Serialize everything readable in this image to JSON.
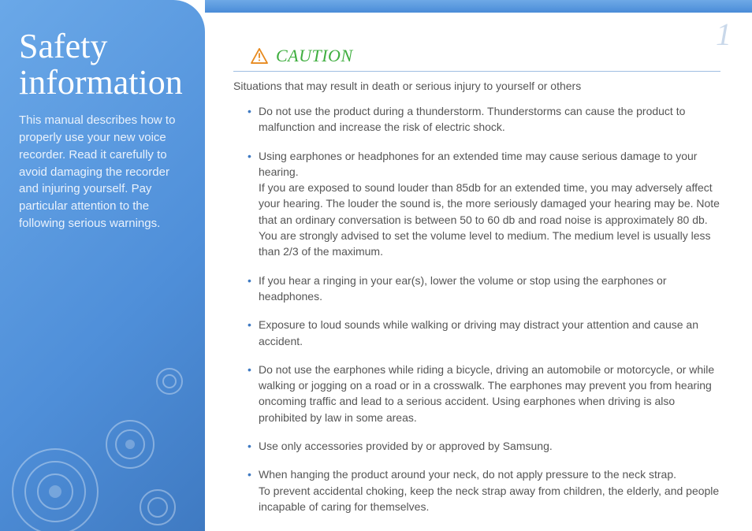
{
  "page_number": "1",
  "sidebar": {
    "title": "Safety information",
    "description": "This manual describes how to properly use your new voice recorder. Read it carefully to avoid damaging the recorder and injuring yourself. Pay particular attention to the following serious warnings."
  },
  "caution": {
    "icon_name": "warning-triangle-icon",
    "label": "CAUTION",
    "lead": "Situations that may result in death or serious injury to yourself or others",
    "items": [
      {
        "text": "Do not use the product during a thunderstorm. Thunderstorms can cause the product to malfunction and increase the risk of electric shock."
      },
      {
        "paras": [
          "Using earphones or headphones for an extended time may cause serious damage to your hearing.",
          "If you are exposed to sound louder than 85db for an extended time, you may adversely affect your hearing. The louder the sound is, the more seriously damaged your hearing may be. Note that an ordinary conversation is between 50 to 60 db and road noise is approximately 80 db.",
          "You are strongly advised to set the volume level to medium. The medium level is usually less than 2/3 of the maximum."
        ]
      },
      {
        "text": "If you hear a ringing in your ear(s), lower the volume or stop using the earphones or headphones."
      },
      {
        "text": "Exposure to loud sounds while walking or driving may distract your attention and cause an accident."
      },
      {
        "text": "Do not use the earphones while riding a bicycle, driving an automobile or motorcycle, or while walking or jogging on a road or in a crosswalk. The earphones may prevent you from hearing oncoming traffic and lead to a serious accident. Using earphones when driving is also prohibited by law in some areas."
      },
      {
        "text": "Use only accessories provided by or approved by Samsung."
      },
      {
        "paras": [
          "When hanging the product around your neck, do not apply pressure to the neck strap.",
          "To prevent accidental choking, keep the neck strap away from children, the elderly, and people incapable of caring for themselves."
        ]
      }
    ]
  },
  "colors": {
    "accent_blue": "#4f8fd9",
    "caution_green": "#3fae3f",
    "rule": "#9fbde2"
  }
}
